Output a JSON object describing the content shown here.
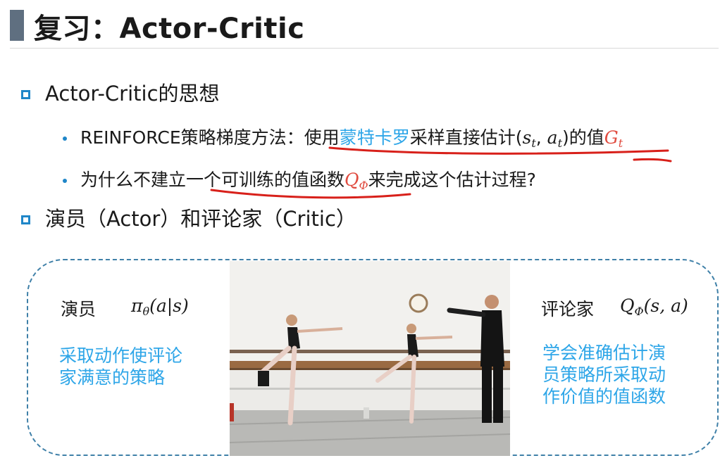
{
  "title": "复习：Actor-Critic",
  "sections": [
    {
      "heading": "Actor-Critic的思想"
    },
    {
      "heading": "演员（Actor）和评论家（Critic）"
    }
  ],
  "bullet1": {
    "prefix": "REINFORCE策略梯度方法：使用",
    "highlight": "蒙特卡罗",
    "middle": "采样直接估计(",
    "s": "s",
    "s_sub": "t",
    "comma": ", ",
    "a": "a",
    "a_sub": "t",
    "end": ")的值",
    "G": "G",
    "G_sub": "t"
  },
  "bullet2": {
    "prefix": "为什么不建立一个可训练的值函数",
    "Q": "Q",
    "Q_sub": "Φ",
    "suffix": "来完成这个估计过程?"
  },
  "actor": {
    "label": "演员",
    "formula_pi": "π",
    "formula_sub": "θ",
    "formula_args": "(a|s)",
    "desc_line1": "采取动作使评论",
    "desc_line2": "家满意的策略"
  },
  "critic": {
    "label": "评论家",
    "formula_Q": "Q",
    "formula_sub": "Φ",
    "formula_args": "(s, a)",
    "desc_line1": "学会准确估计演",
    "desc_line2": "员策略所采取动",
    "desc_line3": "作价值的值函数"
  },
  "photo": {
    "subject": "ballet-class-photo"
  },
  "colors": {
    "accent": "#1f86c8",
    "highlight": "#2ea6e8",
    "annotation": "#d8201a",
    "formula": "#e04b3f"
  }
}
